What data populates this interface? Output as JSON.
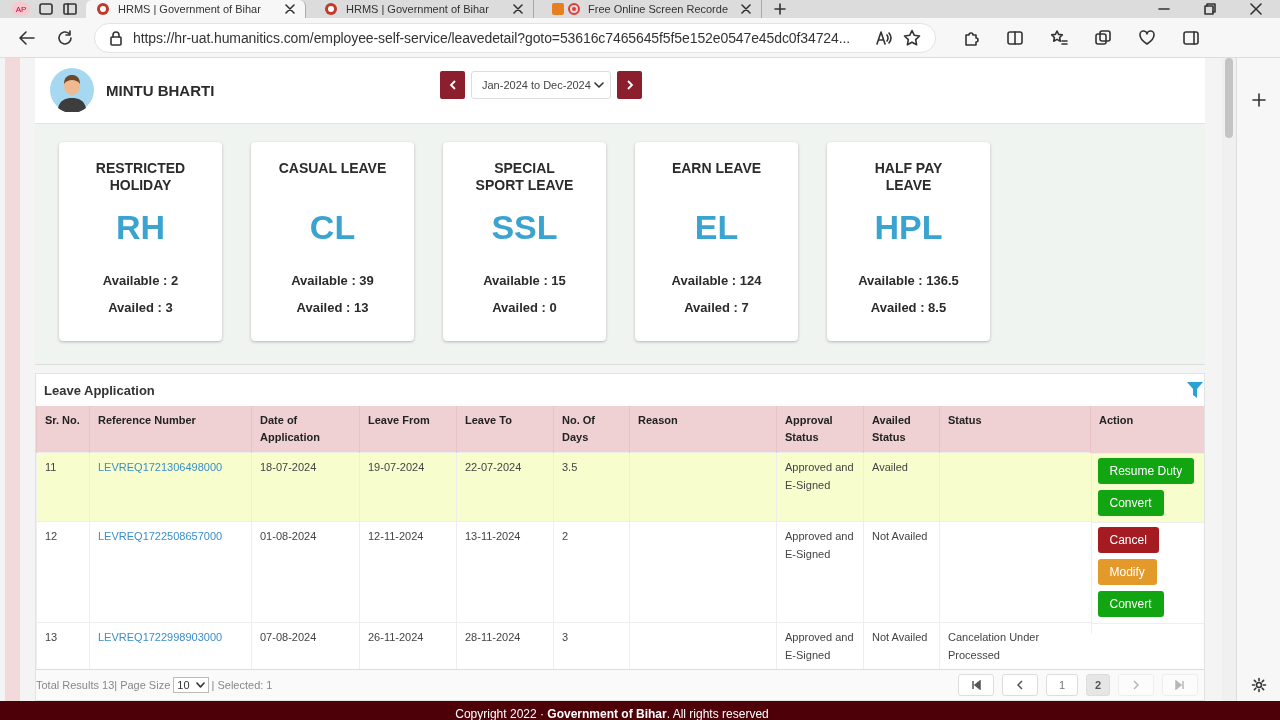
{
  "browser": {
    "tabs": [
      {
        "title": "HRMS | Government of Bihar",
        "selected": true
      },
      {
        "title": "HRMS | Government of Bihar",
        "selected": false
      },
      {
        "title": "Free Online Screen Recorde",
        "selected": false
      }
    ],
    "profile": "AP",
    "url": "https://hr-uat.humanitics.com/employee-self-service/leavedetail?goto=53616c7465645f5f5e152e0547e45dc0f34724..."
  },
  "employee": {
    "name": "MINTU BHARTI"
  },
  "period": {
    "value": "Jan-2024 to Dec-2024"
  },
  "leave_cards": [
    {
      "title": "RESTRICTED HOLIDAY",
      "code": "RH",
      "available": "Available : 2",
      "availed": "Availed : 3"
    },
    {
      "title": "CASUAL LEAVE",
      "code": "CL",
      "available": "Available : 39",
      "availed": "Availed : 13"
    },
    {
      "title": "SPECIAL SPORT LEAVE",
      "code": "SSL",
      "available": "Available : 15",
      "availed": "Availed : 0"
    },
    {
      "title": "EARN LEAVE",
      "code": "EL",
      "available": "Available : 124",
      "availed": "Availed : 7"
    },
    {
      "title": "HALF PAY LEAVE",
      "code": "HPL",
      "available": "Available : 136.5",
      "availed": "Availed : 8.5"
    }
  ],
  "table": {
    "title": "Leave Application",
    "columns": [
      "Sr. No.",
      "Reference Number",
      "Date of Application",
      "Leave From",
      "Leave To",
      "No. Of Days",
      "Reason",
      "Approval Status",
      "Availed Status",
      "Status",
      "Action"
    ],
    "rows": [
      {
        "selected": true,
        "cells": [
          "11",
          "LEVREQ1721306498000",
          "18-07-2024",
          "19-07-2024",
          "22-07-2024",
          "3.5",
          "",
          "Approved and E-Signed",
          "Availed",
          ""
        ],
        "actions": [
          {
            "label": "Resume Duty",
            "kind": "success"
          },
          {
            "label": "Convert",
            "kind": "success"
          }
        ]
      },
      {
        "selected": false,
        "cells": [
          "12",
          "LEVREQ1722508657000",
          "01-08-2024",
          "12-11-2024",
          "13-11-2024",
          "2",
          "",
          "Approved and E-Signed",
          "Not Availed",
          ""
        ],
        "actions": [
          {
            "label": "Cancel",
            "kind": "danger"
          },
          {
            "label": "Modify",
            "kind": "warning"
          },
          {
            "label": "Convert",
            "kind": "success"
          }
        ]
      },
      {
        "selected": false,
        "cells": [
          "13",
          "LEVREQ1722998903000",
          "07-08-2024",
          "26-11-2024",
          "28-11-2024",
          "3",
          "",
          "Approved and E-Signed",
          "Not Availed",
          "Cancelation Under Processed"
        ],
        "actions": []
      }
    ]
  },
  "table_footer": {
    "total": "Total Results 13|",
    "page_size_label": "Page Size",
    "page_size": "10",
    "selected": "| Selected: 1"
  },
  "pagination": [
    {
      "kind": "first",
      "disabled": false,
      "selected": false
    },
    {
      "kind": "prev",
      "disabled": false,
      "selected": false
    },
    {
      "kind": "page",
      "label": "1",
      "disabled": false,
      "selected": false
    },
    {
      "kind": "page",
      "label": "2",
      "disabled": false,
      "selected": true
    },
    {
      "kind": "next",
      "disabled": true,
      "selected": false
    },
    {
      "kind": "last",
      "disabled": true,
      "selected": false
    }
  ],
  "footer": {
    "text": "Copyright 2022 · **Government of Bihar**. All rights reserved"
  }
}
